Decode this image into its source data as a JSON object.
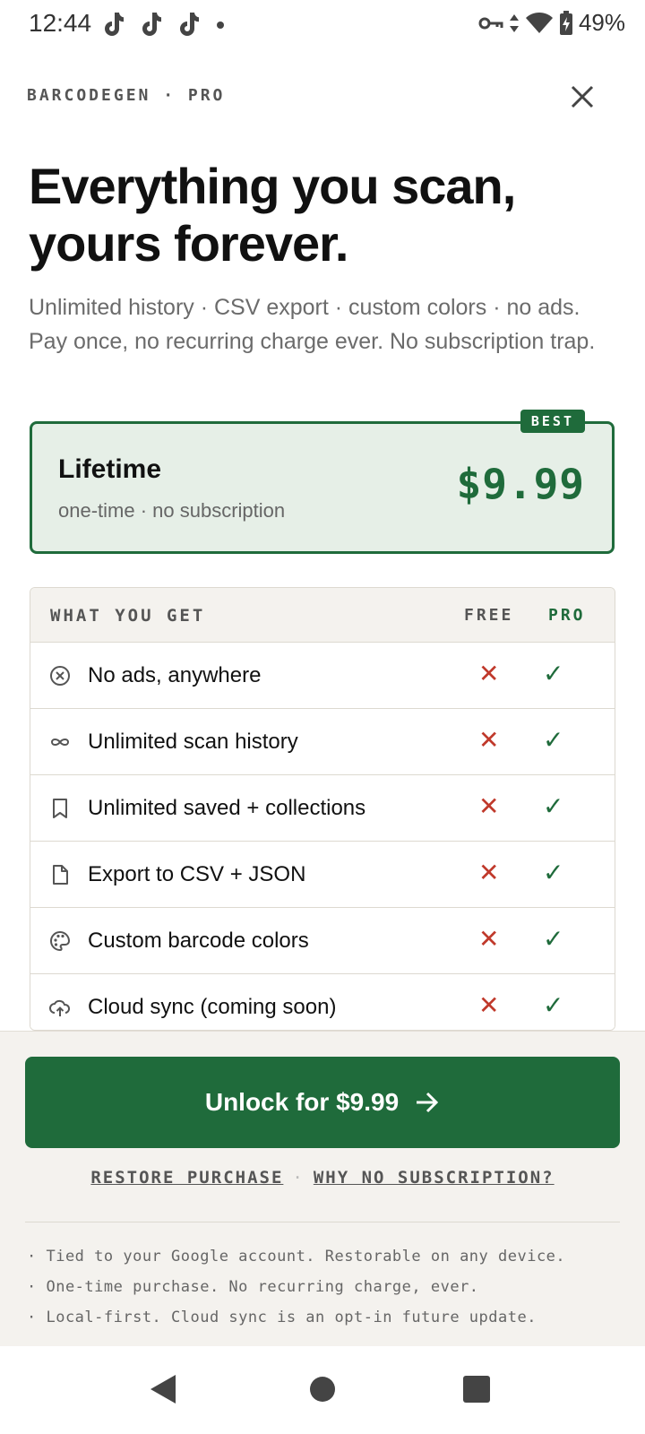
{
  "status_bar": {
    "time": "12:44",
    "notification_icons": [
      "tiktok-icon",
      "tiktok-icon",
      "tiktok-icon"
    ],
    "battery": "49%"
  },
  "header": {
    "brand": "BARCODEGEN · PRO"
  },
  "hero": {
    "title": "Everything you scan, yours forever.",
    "subtitle": "Unlimited history · CSV export · custom colors · no ads. Pay once, no recurring charge ever. No subscription trap."
  },
  "plan": {
    "badge": "BEST",
    "name": "Lifetime",
    "description": "one-time · no subscription",
    "price": "$9.99"
  },
  "features": {
    "header": {
      "what": "WHAT YOU GET",
      "free": "FREE",
      "pro": "PRO"
    },
    "rows": [
      {
        "icon": "no-ads-icon",
        "label": "No ads, anywhere",
        "free": "✕",
        "pro": "✓"
      },
      {
        "icon": "infinity-icon",
        "label": "Unlimited scan history",
        "free": "✕",
        "pro": "✓"
      },
      {
        "icon": "bookmark-icon",
        "label": "Unlimited saved + collections",
        "free": "✕",
        "pro": "✓"
      },
      {
        "icon": "file-icon",
        "label": "Export to CSV + JSON",
        "free": "✕",
        "pro": "✓"
      },
      {
        "icon": "palette-icon",
        "label": "Custom barcode colors",
        "free": "✕",
        "pro": "✓"
      },
      {
        "icon": "cloud-upload-icon",
        "label": "Cloud sync (coming soon)",
        "free": "✕",
        "pro": "✓"
      }
    ]
  },
  "cta": {
    "label": "Unlock for $9.99",
    "restore": "RESTORE PURCHASE",
    "why": "WHY NO SUBSCRIPTION?"
  },
  "notes": [
    "· Tied to your Google account. Restorable on any device.",
    "· One-time purchase. No recurring charge, ever.",
    "· Local-first. Cloud sync is an opt-in future update."
  ],
  "colors": {
    "accent": "#1f6b3b",
    "accent_light": "#e6efe7",
    "negative": "#c0392b",
    "sheet_bg": "#f4f2ee"
  }
}
